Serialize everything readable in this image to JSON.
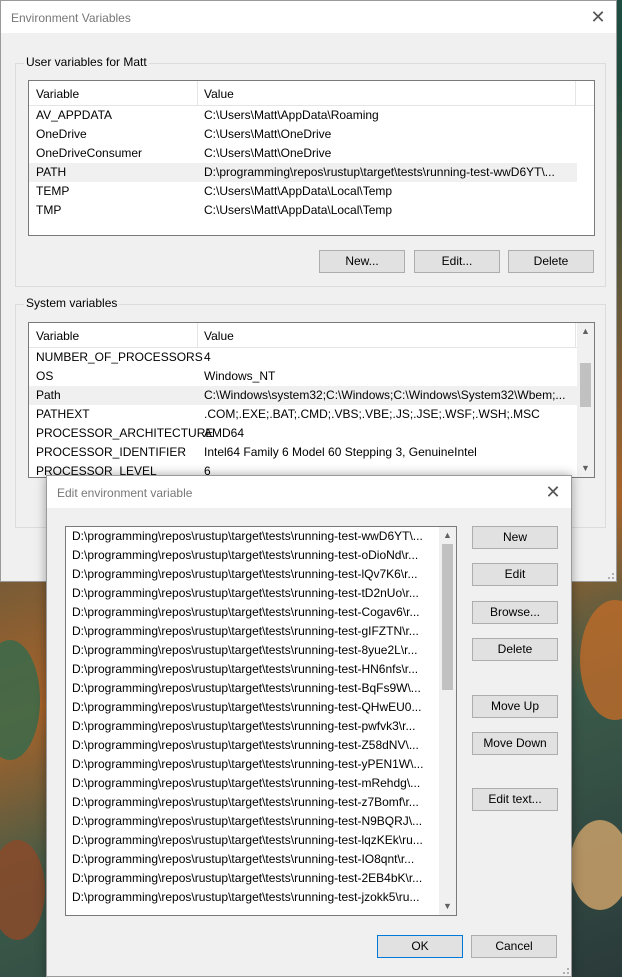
{
  "env_window": {
    "title": "Environment Variables",
    "user_group": {
      "label": "User variables for Matt",
      "headers": [
        "Variable",
        "Value"
      ],
      "rows": [
        {
          "name": "AV_APPDATA",
          "value": "C:\\Users\\Matt\\AppData\\Roaming"
        },
        {
          "name": "OneDrive",
          "value": "C:\\Users\\Matt\\OneDrive"
        },
        {
          "name": "OneDriveConsumer",
          "value": "C:\\Users\\Matt\\OneDrive"
        },
        {
          "name": "PATH",
          "value": "D:\\programming\\repos\\rustup\\target\\tests\\running-test-wwD6YT\\..."
        },
        {
          "name": "TEMP",
          "value": "C:\\Users\\Matt\\AppData\\Local\\Temp"
        },
        {
          "name": "TMP",
          "value": "C:\\Users\\Matt\\AppData\\Local\\Temp"
        }
      ],
      "selected_row": "PATH",
      "buttons": {
        "new": "New...",
        "edit": "Edit...",
        "delete": "Delete"
      }
    },
    "system_group": {
      "label": "System variables",
      "headers": [
        "Variable",
        "Value"
      ],
      "rows": [
        {
          "name": "NUMBER_OF_PROCESSORS",
          "value": "4"
        },
        {
          "name": "OS",
          "value": "Windows_NT"
        },
        {
          "name": "Path",
          "value": "C:\\Windows\\system32;C:\\Windows;C:\\Windows\\System32\\Wbem;..."
        },
        {
          "name": "PATHEXT",
          "value": ".COM;.EXE;.BAT;.CMD;.VBS;.VBE;.JS;.JSE;.WSF;.WSH;.MSC"
        },
        {
          "name": "PROCESSOR_ARCHITECTURE",
          "value": "AMD64"
        },
        {
          "name": "PROCESSOR_IDENTIFIER",
          "value": "Intel64 Family 6 Model 60 Stepping 3, GenuineIntel"
        },
        {
          "name": "PROCESSOR_LEVEL",
          "value": "6"
        }
      ],
      "selected_row": "Path"
    }
  },
  "edit_dialog": {
    "title": "Edit environment variable",
    "entries": [
      "D:\\programming\\repos\\rustup\\target\\tests\\running-test-wwD6YT\\...",
      "D:\\programming\\repos\\rustup\\target\\tests\\running-test-oDioNd\\r...",
      "D:\\programming\\repos\\rustup\\target\\tests\\running-test-lQv7K6\\r...",
      "D:\\programming\\repos\\rustup\\target\\tests\\running-test-tD2nUo\\r...",
      "D:\\programming\\repos\\rustup\\target\\tests\\running-test-Cogav6\\r...",
      "D:\\programming\\repos\\rustup\\target\\tests\\running-test-gIFZTN\\r...",
      "D:\\programming\\repos\\rustup\\target\\tests\\running-test-8yue2L\\r...",
      "D:\\programming\\repos\\rustup\\target\\tests\\running-test-HN6nfs\\r...",
      "D:\\programming\\repos\\rustup\\target\\tests\\running-test-BqFs9W\\...",
      "D:\\programming\\repos\\rustup\\target\\tests\\running-test-QHwEU0...",
      "D:\\programming\\repos\\rustup\\target\\tests\\running-test-pwfvk3\\r...",
      "D:\\programming\\repos\\rustup\\target\\tests\\running-test-Z58dNV\\...",
      "D:\\programming\\repos\\rustup\\target\\tests\\running-test-yPEN1W\\...",
      "D:\\programming\\repos\\rustup\\target\\tests\\running-test-mRehdg\\...",
      "D:\\programming\\repos\\rustup\\target\\tests\\running-test-z7Bomf\\r...",
      "D:\\programming\\repos\\rustup\\target\\tests\\running-test-N9BQRJ\\...",
      "D:\\programming\\repos\\rustup\\target\\tests\\running-test-lqzKEk\\ru...",
      "D:\\programming\\repos\\rustup\\target\\tests\\running-test-IO8qnt\\r...",
      "D:\\programming\\repos\\rustup\\target\\tests\\running-test-2EB4bK\\r...",
      "D:\\programming\\repos\\rustup\\target\\tests\\running-test-jzokk5\\ru..."
    ],
    "buttons": {
      "new": "New",
      "edit": "Edit",
      "browse": "Browse...",
      "delete": "Delete",
      "move_up": "Move Up",
      "move_down": "Move Down",
      "edit_text": "Edit text...",
      "ok": "OK",
      "cancel": "Cancel"
    }
  }
}
